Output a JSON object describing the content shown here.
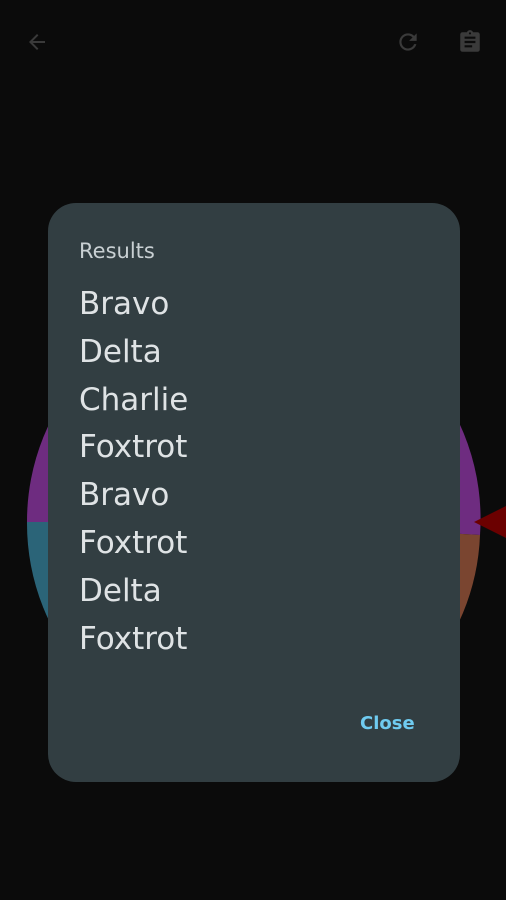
{
  "topbar": {
    "back_icon": "arrow-back-icon",
    "refresh_icon": "refresh-icon",
    "clipboard_icon": "clipboard-icon"
  },
  "wheel": {
    "segment_colors": [
      "#7b2f8f",
      "#2a6a82",
      "#8a4a2e"
    ],
    "pointer_color": "#7a0000"
  },
  "dialog": {
    "title": "Results",
    "results": [
      "Bravo",
      "Delta",
      "Charlie",
      "Foxtrot",
      "Bravo",
      "Foxtrot",
      "Delta",
      "Foxtrot"
    ],
    "close_label": "Close",
    "background": "#323e42",
    "accent": "#6fcbf0"
  }
}
